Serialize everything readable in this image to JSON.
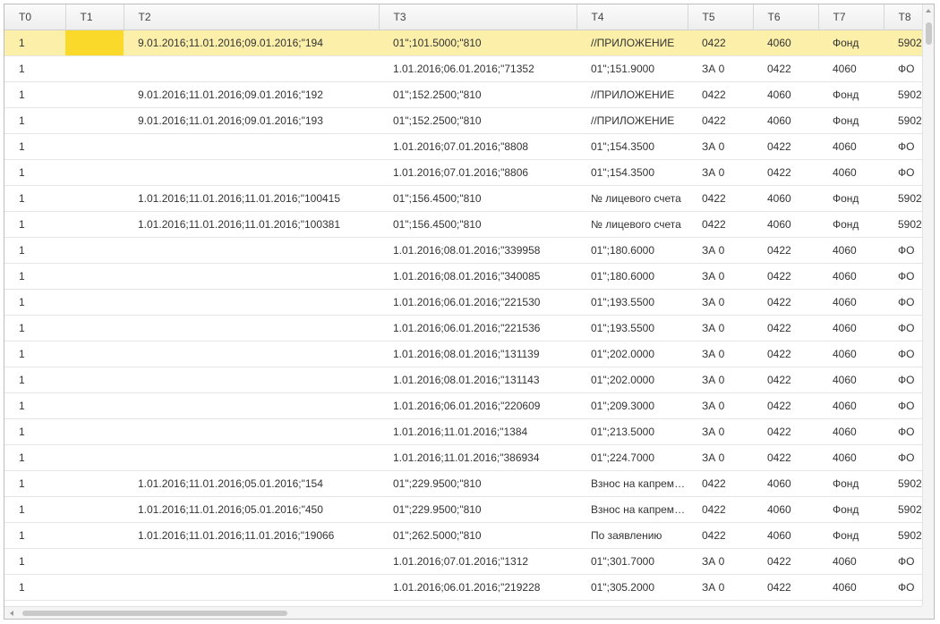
{
  "colors": {
    "selected_row": "#fbefaa",
    "active_cell": "#fbd92b",
    "header_bg": "#eeeeee",
    "border": "#bdbdbd"
  },
  "table": {
    "columns": [
      "T0",
      "T1",
      "T2",
      "T3",
      "T4",
      "T5",
      "T6",
      "T7",
      "T8"
    ],
    "selected_row": 0,
    "active_column": 1,
    "rows": [
      [
        "1",
        "",
        "9.01.2016;11.01.2016;09.01.2016;\"194",
        "01\";101.5000;\"810",
        "//ПРИЛОЖЕНИЕ",
        "0422",
        "4060",
        "Фонд",
        "5902"
      ],
      [
        "1",
        "",
        "",
        "1.01.2016;06.01.2016;\"71352",
        "01\";151.9000",
        "ЗА 0",
        "0422",
        "4060",
        "ФО"
      ],
      [
        "1",
        "",
        "9.01.2016;11.01.2016;09.01.2016;\"192",
        "01\";152.2500;\"810",
        "//ПРИЛОЖЕНИЕ",
        "0422",
        "4060",
        "Фонд",
        "5902"
      ],
      [
        "1",
        "",
        "9.01.2016;11.01.2016;09.01.2016;\"193",
        "01\";152.2500;\"810",
        "//ПРИЛОЖЕНИЕ",
        "0422",
        "4060",
        "Фонд",
        "5902"
      ],
      [
        "1",
        "",
        "",
        "1.01.2016;07.01.2016;\"8808",
        "01\";154.3500",
        "ЗА 0",
        "0422",
        "4060",
        "ФО"
      ],
      [
        "1",
        "",
        "",
        "1.01.2016;07.01.2016;\"8806",
        "01\";154.3500",
        "ЗА 0",
        "0422",
        "4060",
        "ФО"
      ],
      [
        "1",
        "",
        "1.01.2016;11.01.2016;11.01.2016;\"100415",
        "01\";156.4500;\"810",
        "№ лицевого счета",
        "0422",
        "4060",
        "Фонд",
        "5902"
      ],
      [
        "1",
        "",
        "1.01.2016;11.01.2016;11.01.2016;\"100381",
        "01\";156.4500;\"810",
        "№ лицевого счета",
        "0422",
        "4060",
        "Фонд",
        "5902"
      ],
      [
        "1",
        "",
        "",
        "1.01.2016;08.01.2016;\"339958",
        "01\";180.6000",
        "ЗА 0",
        "0422",
        "4060",
        "ФО"
      ],
      [
        "1",
        "",
        "",
        "1.01.2016;08.01.2016;\"340085",
        "01\";180.6000",
        "ЗА 0",
        "0422",
        "4060",
        "ФО"
      ],
      [
        "1",
        "",
        "",
        "1.01.2016;06.01.2016;\"221530",
        "01\";193.5500",
        "ЗА 0",
        "0422",
        "4060",
        "ФО"
      ],
      [
        "1",
        "",
        "",
        "1.01.2016;06.01.2016;\"221536",
        "01\";193.5500",
        "ЗА 0",
        "0422",
        "4060",
        "ФО"
      ],
      [
        "1",
        "",
        "",
        "1.01.2016;08.01.2016;\"131139",
        "01\";202.0000",
        "ЗА 0",
        "0422",
        "4060",
        "ФО"
      ],
      [
        "1",
        "",
        "",
        "1.01.2016;08.01.2016;\"131143",
        "01\";202.0000",
        "ЗА 0",
        "0422",
        "4060",
        "ФО"
      ],
      [
        "1",
        "",
        "",
        "1.01.2016;06.01.2016;\"220609",
        "01\";209.3000",
        "ЗА 0",
        "0422",
        "4060",
        "ФО"
      ],
      [
        "1",
        "",
        "",
        "1.01.2016;11.01.2016;\"1384",
        "01\";213.5000",
        "ЗА 0",
        "0422",
        "4060",
        "ФО"
      ],
      [
        "1",
        "",
        "",
        "1.01.2016;11.01.2016;\"386934",
        "01\";224.7000",
        "ЗА 0",
        "0422",
        "4060",
        "ФО"
      ],
      [
        "1",
        "",
        "1.01.2016;11.01.2016;05.01.2016;\"154",
        "01\";229.9500;\"810",
        "Взнос на капремонт",
        "0422",
        "4060",
        "Фонд",
        "5902"
      ],
      [
        "1",
        "",
        "1.01.2016;11.01.2016;05.01.2016;\"450",
        "01\";229.9500;\"810",
        "Взнос на капремонт",
        "0422",
        "4060",
        "Фонд",
        "5902"
      ],
      [
        "1",
        "",
        "1.01.2016;11.01.2016;11.01.2016;\"19066",
        "01\";262.5000;\"810",
        "По заявлению",
        "0422",
        "4060",
        "Фонд",
        "5902"
      ],
      [
        "1",
        "",
        "",
        "1.01.2016;07.01.2016;\"1312",
        "01\";301.7000",
        "ЗА 0",
        "0422",
        "4060",
        "ФО"
      ],
      [
        "1",
        "",
        "",
        "1.01.2016;06.01.2016;\"219228",
        "01\";305.2000",
        "ЗА 0",
        "0422",
        "4060",
        "ФО"
      ]
    ]
  }
}
